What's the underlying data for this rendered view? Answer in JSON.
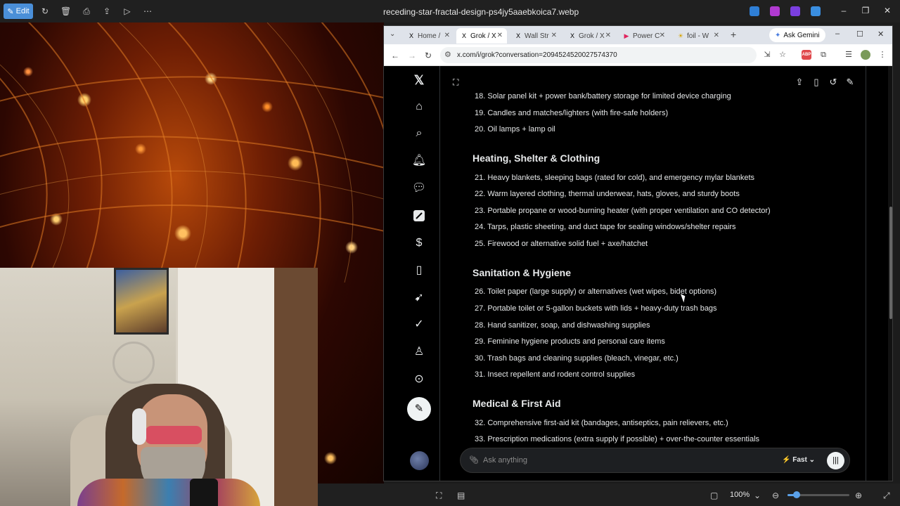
{
  "viewer": {
    "edit_label": "Edit",
    "file_title": "receding-star-fractal-design-ps4jy5aaebkoica7.webp",
    "zoom": "100%",
    "zoom_fraction": 0.15
  },
  "browser": {
    "tabs": [
      {
        "label": "Home /",
        "favicon": "X"
      },
      {
        "label": "Grok / X",
        "favicon": "X"
      },
      {
        "label": "Wall Str",
        "favicon": "X"
      },
      {
        "label": "Grok / X",
        "favicon": "X"
      },
      {
        "label": "Power C",
        "favicon": "▶"
      },
      {
        "label": "foil - W",
        "favicon": "☀"
      }
    ],
    "gemini_label": "Ask Gemini",
    "url": "x.com/i/grok?conversation=2094524520027574370"
  },
  "grok": {
    "items_top": [
      "18. Solar panel kit + power bank/battery storage for limited device charging",
      "19. Candles and matches/lighters (with fire-safe holders)",
      "20. Oil lamps + lamp oil"
    ],
    "heading_heating": "Heating, Shelter & Clothing",
    "items_heating": [
      "21. Heavy blankets, sleeping bags (rated for cold), and emergency mylar blankets",
      "22. Warm layered clothing, thermal underwear, hats, gloves, and sturdy boots",
      "23. Portable propane or wood-burning heater (with proper ventilation and CO detector)",
      "24. Tarps, plastic sheeting, and duct tape for sealing windows/shelter repairs",
      "25. Firewood or alternative solid fuel + axe/hatchet"
    ],
    "heading_sanitation": "Sanitation & Hygiene",
    "items_sanitation": [
      "26. Toilet paper (large supply) or alternatives (wet wipes, bidet options)",
      "27. Portable toilet or 5-gallon buckets with lids + heavy-duty trash bags",
      "28. Hand sanitizer, soap, and dishwashing supplies",
      "29. Feminine hygiene products and personal care items",
      "30. Trash bags and cleaning supplies (bleach, vinegar, etc.)",
      "31. Insect repellent and rodent control supplies"
    ],
    "heading_medical": "Medical & First Aid",
    "items_medical": [
      "32. Comprehensive first-aid kit (bandages, antiseptics, pain relievers, etc.)",
      "33. Prescription medications (extra supply if possible) + over-the-counter essentials"
    ],
    "ask_placeholder": "Ask anything",
    "mode_label": "Fast"
  }
}
